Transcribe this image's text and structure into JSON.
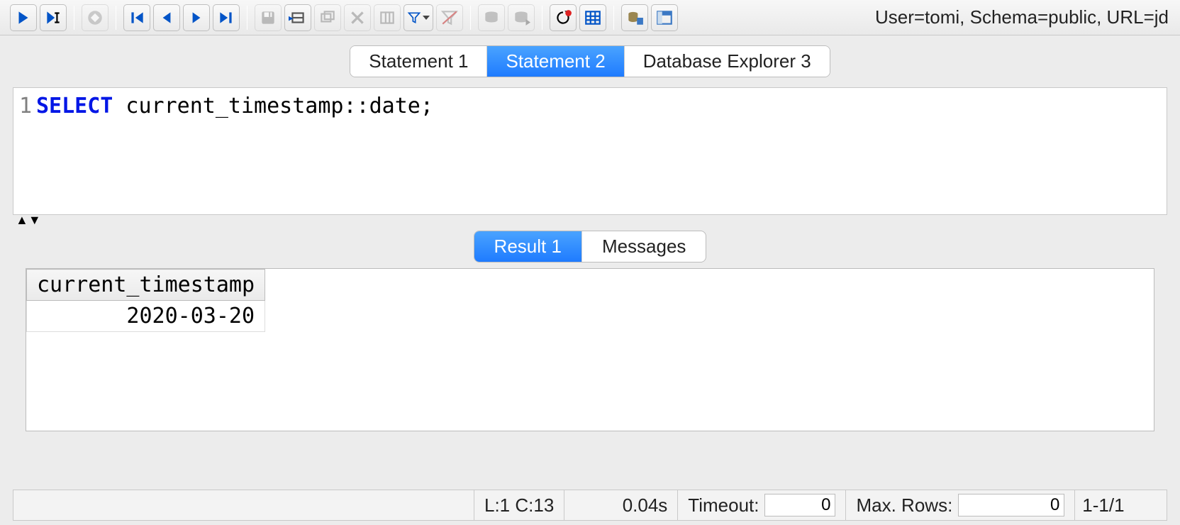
{
  "toolbar": {
    "connection_info": "User=tomi, Schema=public, URL=jd"
  },
  "tabs": [
    {
      "label": "Statement 1",
      "active": false
    },
    {
      "label": "Statement 2",
      "active": true
    },
    {
      "label": "Database Explorer 3",
      "active": false
    }
  ],
  "editor": {
    "line_number": "1",
    "sql_keyword": "SELECT",
    "sql_rest": " current_timestamp::date;"
  },
  "result_tabs": [
    {
      "label": "Result 1",
      "active": true
    },
    {
      "label": "Messages",
      "active": false
    }
  ],
  "result": {
    "columns": [
      "current_timestamp"
    ],
    "rows": [
      [
        "2020-03-20"
      ]
    ]
  },
  "statusbar": {
    "cursor": "L:1 C:13",
    "exec_time": "0.04s",
    "timeout_label": "Timeout:",
    "timeout_value": "0",
    "maxrows_label": "Max. Rows:",
    "maxrows_value": "0",
    "row_range": "1-1/1"
  },
  "icons": {
    "run": "run-icon",
    "run_cursor": "run-at-cursor-icon",
    "stop": "stop-icon",
    "first": "first-record-icon",
    "prev": "prev-record-icon",
    "next": "next-record-icon",
    "last": "last-record-icon",
    "save": "save-icon",
    "insert_row": "insert-row-icon",
    "copy_row": "copy-row-icon",
    "delete_row": "delete-row-icon",
    "columns": "select-columns-icon",
    "filter": "filter-icon",
    "filter_clear": "clear-filter-icon",
    "db1": "database-commit-icon",
    "db2": "database-rollback-icon",
    "refresh": "refresh-warning-icon",
    "grid": "grid-options-icon",
    "db_tree": "db-tree-icon",
    "db_panel": "db-panel-icon"
  }
}
